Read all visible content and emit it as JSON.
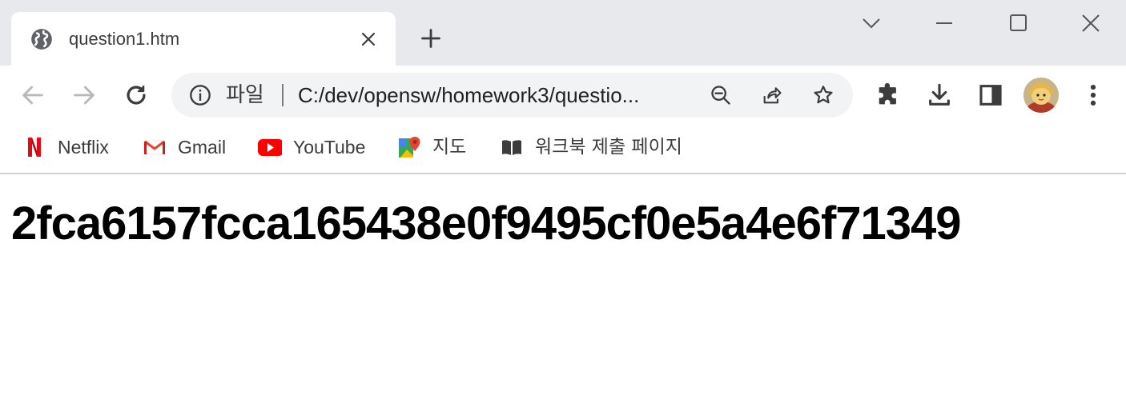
{
  "tab": {
    "title": "question1.htm",
    "favicon": "globe-icon"
  },
  "toolbar": {
    "url_scheme_label": "파일",
    "url": "C:/dev/opensw/homework3/questio...",
    "icons": [
      "back-arrow-icon",
      "forward-arrow-icon",
      "reload-icon",
      "info-icon",
      "zoom-out-icon",
      "share-icon",
      "star-icon",
      "extensions-icon",
      "download-icon",
      "side-panel-icon",
      "more-vert-icon"
    ]
  },
  "bookmarks": [
    {
      "label": "Netflix",
      "icon": "netflix-icon"
    },
    {
      "label": "Gmail",
      "icon": "gmail-icon"
    },
    {
      "label": "YouTube",
      "icon": "youtube-icon"
    },
    {
      "label": "지도",
      "icon": "maps-icon"
    },
    {
      "label": "워크북 제출 페이지",
      "icon": "book-icon"
    }
  ],
  "page": {
    "heading": "2fca6157fcca165438e0f9495cf0e5a4e6f71349"
  },
  "colors": {
    "tab_strip_bg": "#e8e9ed",
    "omnibox_bg": "#f1f3f4",
    "youtube_red": "#ff0000",
    "netflix_red": "#e50914"
  }
}
